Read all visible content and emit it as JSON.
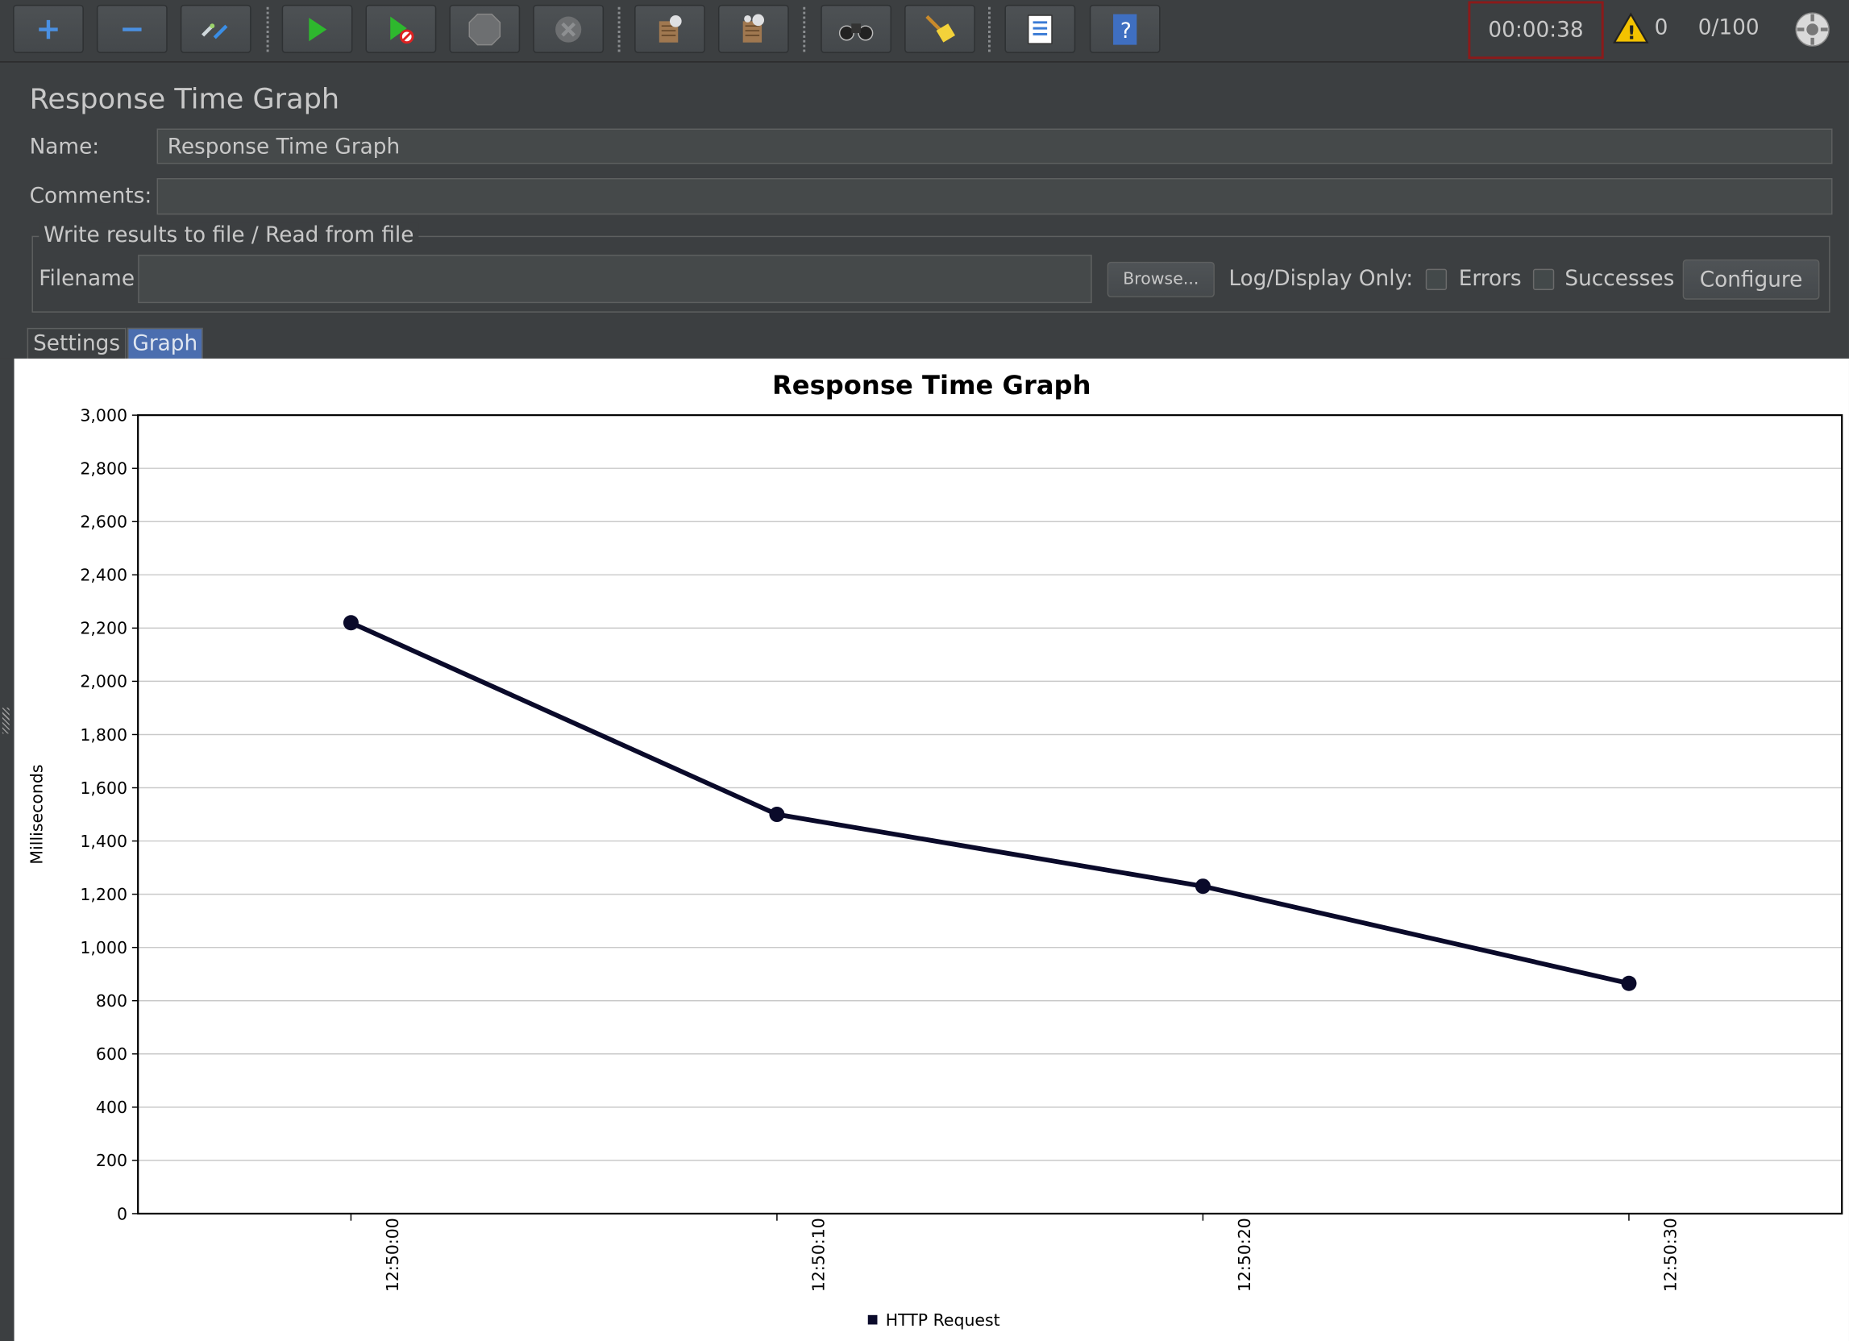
{
  "toolbar": {
    "buttons": [
      {
        "name": "add-button",
        "icon": "plus-icon"
      },
      {
        "name": "remove-button",
        "icon": "minus-icon"
      },
      {
        "name": "toggle-button",
        "icon": "toggle-icon"
      },
      {
        "name": "start-button",
        "icon": "play-icon"
      },
      {
        "name": "start-no-pauses-button",
        "icon": "play-no-timers-icon"
      },
      {
        "name": "stop-button",
        "icon": "stop-icon"
      },
      {
        "name": "shutdown-button",
        "icon": "shutdown-icon"
      },
      {
        "name": "clear-button",
        "icon": "clear-icon"
      },
      {
        "name": "clear-all-button",
        "icon": "clear-all-icon"
      },
      {
        "name": "search-button",
        "icon": "binoculars-icon"
      },
      {
        "name": "reset-search-button",
        "icon": "broom-icon"
      },
      {
        "name": "function-helper-button",
        "icon": "function-list-icon"
      },
      {
        "name": "help-button",
        "icon": "help-book-icon"
      }
    ],
    "timer": "00:00:38",
    "warning_count": "0",
    "threads": "0/100"
  },
  "panel": {
    "title": "Response Time Graph",
    "name_label": "Name:",
    "name_value": "Response Time Graph",
    "comments_label": "Comments:",
    "comments_value": "",
    "file_section_label": "Write results to file / Read from file",
    "filename_label": "Filename",
    "filename_value": "",
    "browse_label": "Browse...",
    "log_display_label": "Log/Display Only:",
    "errors_label": "Errors",
    "successes_label": "Successes",
    "configure_label": "Configure"
  },
  "tabs": [
    {
      "label": "Settings",
      "active": false
    },
    {
      "label": "Graph",
      "active": true
    }
  ],
  "chart_data": {
    "type": "line",
    "title": "Response Time Graph",
    "ylabel": "Milliseconds",
    "xlabel": "",
    "ylim": [
      0,
      3000
    ],
    "y_ticks": [
      "0",
      "200",
      "400",
      "600",
      "800",
      "1,000",
      "1,200",
      "1,400",
      "1,600",
      "1,800",
      "2,000",
      "2,200",
      "2,400",
      "2,600",
      "2,800",
      "3,000"
    ],
    "categories": [
      "12:50:00",
      "12:50:10",
      "12:50:20",
      "12:50:30"
    ],
    "series": [
      {
        "name": "HTTP Request",
        "values": [
          2220,
          1500,
          1230,
          865
        ],
        "color": "#0a0a2a"
      }
    ],
    "grid": true,
    "legend": "bottom"
  },
  "colors": {
    "background": "#3c3f41",
    "timer_border": "#8b1a1a",
    "active_tab": "#4b6eaf"
  }
}
